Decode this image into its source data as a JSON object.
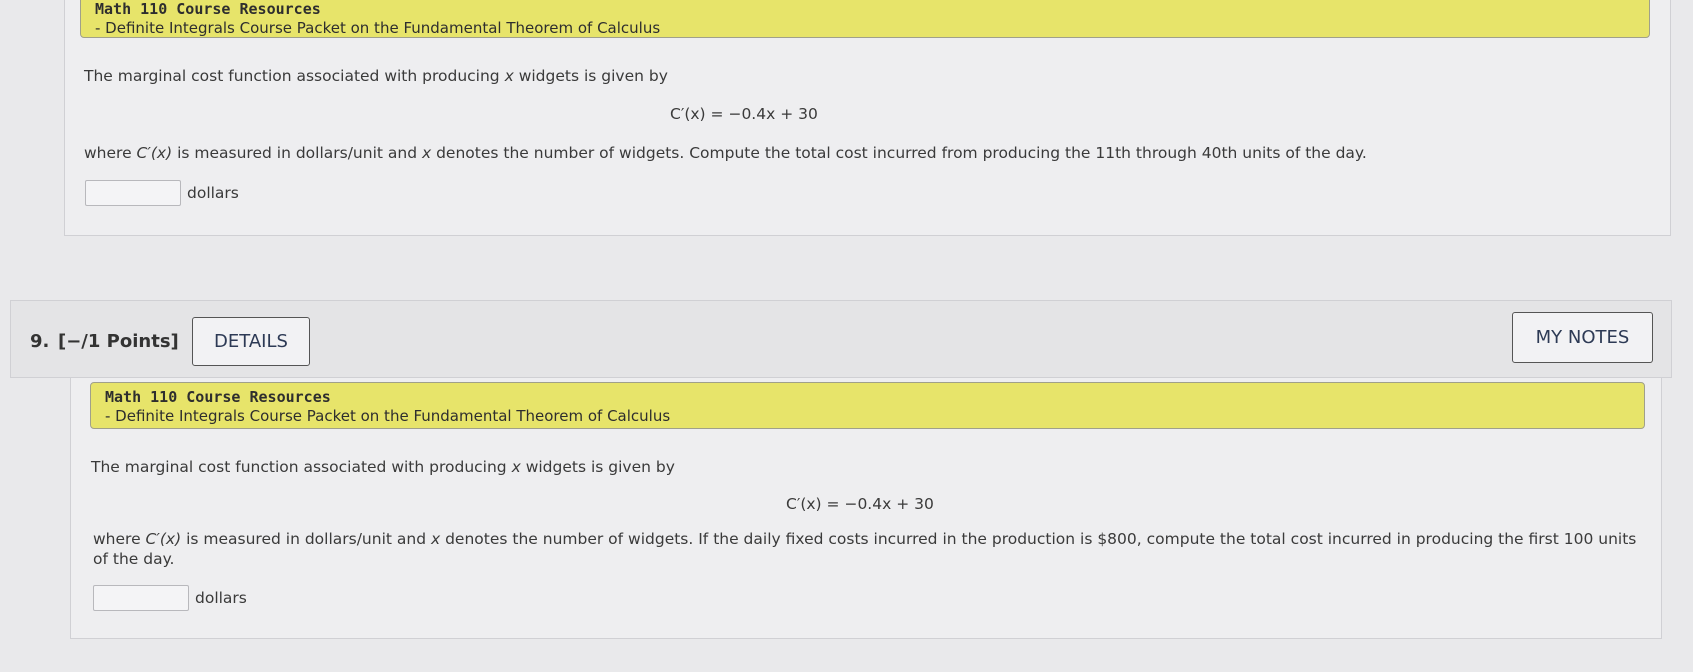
{
  "q8": {
    "resource_title": "Math 110 Course Resources",
    "resource_link": "- Definite Integrals Course Packet on the Fundamental Theorem of Calculus",
    "intro_pre": "The marginal cost function associated with producing ",
    "intro_var": "x",
    "intro_post": " widgets is given by",
    "formula": "C′(x) = −0.4x + 30",
    "where_a": "where ",
    "where_fn": "C′(x)",
    "where_b": " is measured in dollars/unit and ",
    "where_var": "x",
    "where_c": " denotes the number of widgets. Compute the total cost incurred from producing the 11th through 40th units of the day.",
    "answer_value": "",
    "unit": "dollars"
  },
  "q9": {
    "number": "9.",
    "points": "[−/1 Points]",
    "details_label": "DETAILS",
    "notes_label": "MY NOTES",
    "resource_title": "Math 110 Course Resources",
    "resource_link": "- Definite Integrals Course Packet on the Fundamental Theorem of Calculus",
    "intro_pre": "The marginal cost function associated with producing ",
    "intro_var": "x",
    "intro_post": " widgets is given by",
    "formula": "C′(x) = −0.4x + 30",
    "where_a": "where ",
    "where_fn": "C′(x)",
    "where_b": " is measured in dollars/unit and ",
    "where_var": "x",
    "where_c": " denotes the number of widgets. If the daily fixed costs incurred in the production is $800, compute the total cost incurred in producing the first 100 units of the day.",
    "answer_value": "",
    "unit": "dollars"
  }
}
